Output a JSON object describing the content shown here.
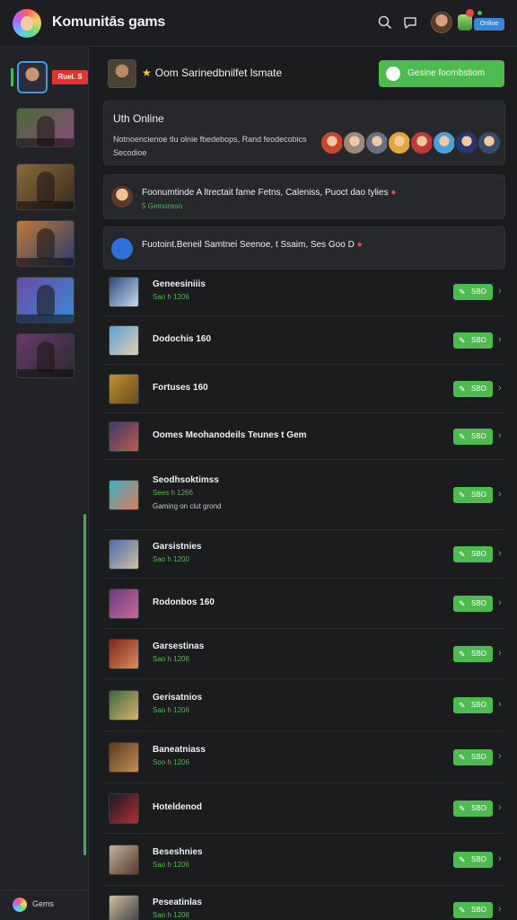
{
  "header": {
    "title": "Komunitās gams",
    "icons": [
      "search-icon",
      "chat-icon",
      "avatar",
      "notification-badge",
      "profile-icon"
    ],
    "pill_label": "Online"
  },
  "sidebar": {
    "live_label": "Ruel. S",
    "thumbs": [
      {
        "name": "Game 1",
        "caption": "",
        "colors": [
          "#4a6a3a",
          "#8a4a7a"
        ]
      },
      {
        "name": "Game 2",
        "caption": "",
        "colors": [
          "#8a6a3a",
          "#3a2a20"
        ]
      },
      {
        "name": "Game 3",
        "caption": "",
        "colors": [
          "#c07a3a",
          "#2a3a6a"
        ]
      },
      {
        "name": "Game 4",
        "caption": "",
        "colors": [
          "#6a4aa8",
          "#3a8ad0"
        ]
      },
      {
        "name": "Game 5",
        "caption": "",
        "colors": [
          "#6a3a6a",
          "#2a2a30"
        ]
      }
    ],
    "footer_label": "Gems"
  },
  "main": {
    "top_title": "Oom Sarinedbnilfet lsmate",
    "cta_label": "Gesine foombstiom",
    "online": {
      "title": "Uth Online",
      "text": "Notnoencienoe tlu olnie fbedebops, Rand feodecobics Secodioe",
      "avatars": [
        "#c9472f",
        "#9a8a7a",
        "#6a6f86",
        "#e0a73a",
        "#c13a3a",
        "#4aa0d8",
        "#2a3470",
        "#3a4a6a"
      ]
    },
    "notif1": {
      "text": "Foonumtinde A ltrectait fame Fetns, Caleniss, Puoct dao tylies",
      "sub": "5 Gemonsso"
    },
    "notif2": {
      "text": "Fuotoint.Beneil Samtnei Seenoe, t Ssaim, Ses Goo D"
    },
    "games": [
      {
        "name": "Geneesiniiis",
        "sub": "Sao h 1206",
        "extra": "",
        "btn": "SBO",
        "h": 54,
        "thumb": [
          "#2a4a7a",
          "#c8d8f0"
        ]
      },
      {
        "name": "Dodochis 160",
        "sub": "",
        "extra": "",
        "btn": "SBO",
        "h": 54,
        "thumb": [
          "#5aa0d8",
          "#e0d0b0"
        ]
      },
      {
        "name": "Fortuses 160",
        "sub": "",
        "extra": "",
        "btn": "SBO",
        "h": 54,
        "thumb": [
          "#c09030",
          "#6a4a20"
        ]
      },
      {
        "name": "Oomes Meohanodeils Teunes t Gem",
        "sub": "",
        "extra": "",
        "btn": "SBO",
        "h": 52,
        "thumb": [
          "#3a3a6a",
          "#c05a4a"
        ]
      },
      {
        "name": "Seodhsoktimss",
        "sub": "Sees h 1266",
        "extra": "Gaming on clut grond",
        "btn": "SBO",
        "h": 78,
        "thumb": [
          "#3ab0c0",
          "#e07a5a"
        ]
      },
      {
        "name": "Garsistnies",
        "sub": "Sao h 1200",
        "extra": "",
        "btn": "SBO",
        "h": 54,
        "thumb": [
          "#4a6ab0",
          "#d0c0a0"
        ]
      },
      {
        "name": "Rodonbos 160",
        "sub": "",
        "extra": "",
        "btn": "SBO",
        "h": 56,
        "thumb": [
          "#6a3a7a",
          "#c86a9a"
        ]
      },
      {
        "name": "Garsestinas",
        "sub": "Sao h 1206",
        "extra": "",
        "btn": "SBO",
        "h": 56,
        "thumb": [
          "#7a2a1a",
          "#e08a5a"
        ]
      },
      {
        "name": "Gerisatnios",
        "sub": "Sao h 1206",
        "extra": "",
        "btn": "SBO",
        "h": 58,
        "thumb": [
          "#3a6a3a",
          "#d8b070"
        ]
      },
      {
        "name": "Baneatniass",
        "sub": "Soo h 1206",
        "extra": "",
        "btn": "SBO",
        "h": 58,
        "thumb": [
          "#5a3a1a",
          "#c0905a"
        ]
      },
      {
        "name": "Hoteldenod",
        "sub": "",
        "extra": "",
        "btn": "SBO",
        "h": 56,
        "thumb": [
          "#1a1a2a",
          "#b03030"
        ]
      },
      {
        "name": "Beseshnies",
        "sub": "Sao h 1206",
        "extra": "",
        "btn": "SBO",
        "h": 58,
        "thumb": [
          "#c0b0a0",
          "#5a3a2a"
        ]
      },
      {
        "name": "Peseatinlas",
        "sub": "Sao h 1206",
        "extra": "",
        "btn": "SBO",
        "h": 54,
        "thumb": [
          "#d0c0a0",
          "#3a3a40"
        ]
      }
    ]
  }
}
